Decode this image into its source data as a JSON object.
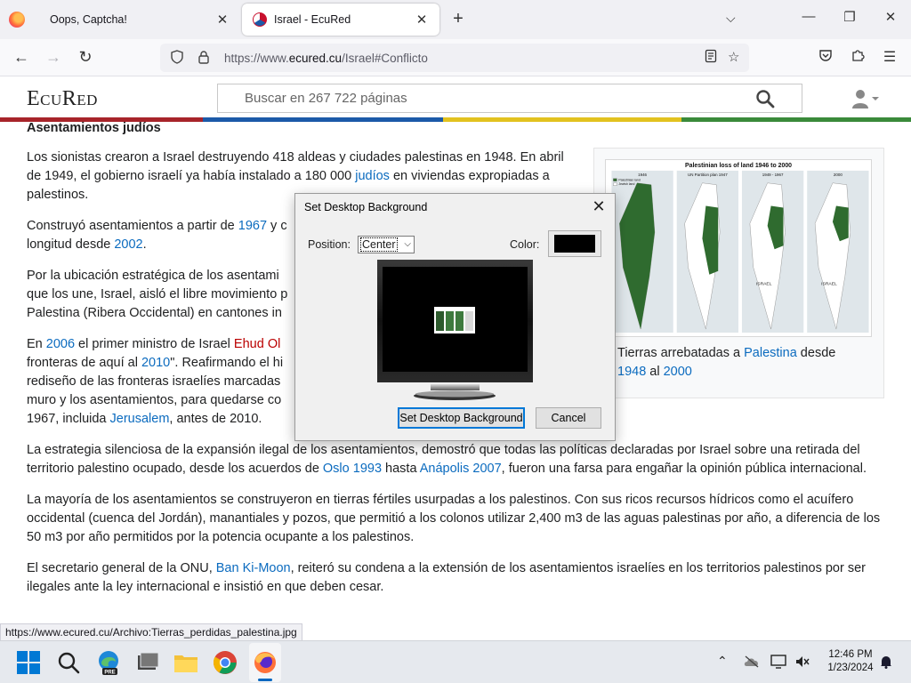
{
  "browser": {
    "tabs": [
      {
        "title": "Oops, Captcha!",
        "active": false
      },
      {
        "title": "Israel - EcuRed",
        "active": true
      }
    ],
    "url": {
      "prefix": "https://www.",
      "domain": "ecured.cu",
      "path": "/Israel#Conflicto"
    },
    "status_url": "https://www.ecured.cu/Archivo:Tierras_perdidas_palestina.jpg"
  },
  "site": {
    "logo": "EcuRed",
    "search_placeholder": "Buscar en 267 722 páginas",
    "stripe_colors": [
      "#a7242a",
      "#1c5aa8",
      "#e2c21f",
      "#3a8a3a"
    ]
  },
  "article": {
    "section_title": "Asentamientos judíos",
    "p1": {
      "a": "Los sionistas crearon a Israel destruyendo 418 aldeas y ciudades palestinas en 1948. En abril de 1949, el gobierno israelí ya había instalado a 180 000 ",
      "link": "judíos",
      "b": " en viviendas expropiadas a palestinos."
    },
    "p2": {
      "a": "Construyó asentamientos a partir de ",
      "link1": "1967",
      "b": " y c",
      "c": "longitud desde ",
      "link2": "2002",
      "d": "."
    },
    "p3": {
      "a": "Por la ubicación estratégica de los asentami",
      "b": "que los une, Israel, aisló el libre movimiento p",
      "c": "Palestina (Ribera Occidental) en cantones in"
    },
    "p4": {
      "a": "En ",
      "link1": "2006",
      "b": " el primer ministro de Israel ",
      "link_red": "Ehud Ol",
      "c": "fronteras de aquí al ",
      "link2": "2010",
      "d": "\". Reafirmando el hi",
      "e": "rediseño de las fronteras israelíes marcadas",
      "f": "muro y los asentamientos, para quedarse co",
      "g": "1967, incluida ",
      "link3": "Jerusalem",
      "h": ", antes de 2010."
    },
    "p5": {
      "a": "La estrategia silenciosa de la expansión ilegal de los asentamientos, demostró que todas las políticas declaradas por Israel sobre una retirada del territorio palestino ocupado, desde los acuerdos de ",
      "link1": "Oslo 1993",
      "b": " hasta ",
      "link2": "Anápolis 2007",
      "c": ", fueron una farsa para engañar la opinión pública internacional."
    },
    "p6": "La mayoría de los asentamientos se construyeron en tierras fértiles usurpadas a los palestinos. Con sus ricos recursos hídricos como el acuífero occidental (cuenca del Jordán), manantiales y pozos, que permitió a los colonos utilizar 2,400 m3 de las aguas palestinas por año, a diferencia de los 50 m3 por año permitidos por la potencia ocupante a los palestinos.",
    "p7": {
      "a": "El secretario general de la ONU, ",
      "link": "Ban Ki-Moon",
      "b": ", reiteró su condena a la extensión de los asentamientos israelíes en los territorios palestinos por ser ilegales ante la ley internacional e insistió en que deben cesar."
    },
    "figure": {
      "map_title": "Palestinian loss of land 1946 to 2000",
      "map_labels": [
        "1946",
        "UN Partition plan 1947",
        "1949 - 1967",
        "2000"
      ],
      "map_legend": [
        "Palestinian land",
        "Jewish land"
      ],
      "map_panel_label": "ISRAEL",
      "caption_a": "Tierras arrebatadas a ",
      "caption_link1": "Palestina",
      "caption_b": " desde ",
      "caption_link2": "1948",
      "caption_c": " al ",
      "caption_link3": "2000"
    }
  },
  "dialog": {
    "title": "Set Desktop Background",
    "position_label": "Position:",
    "position_value": "Center",
    "color_label": "Color:",
    "color_value": "#000000",
    "primary_button": "Set Desktop Background",
    "cancel_button": "Cancel"
  },
  "taskbar": {
    "time": "12:46 PM",
    "date": "1/23/2024",
    "edge_badge": "PRE"
  }
}
